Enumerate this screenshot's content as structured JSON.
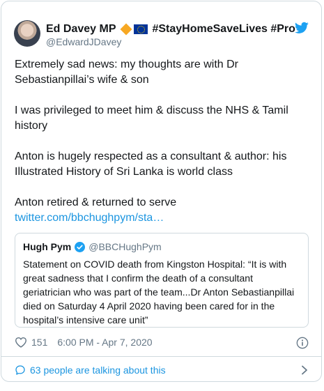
{
  "tweet": {
    "author_name": "Ed Davey MP",
    "author_tags": "#StayHomeSaveLives #Pro",
    "author_handle": "@EdwardJDavey",
    "paragraphs": [
      "Extremely sad news: my thoughts are with Dr Sebastianpillai’s wife & son",
      "I was privileged to meet him & discuss the NHS & Tamil history",
      "Anton is hugely respected as a consultant & author: his Illustrated History of Sri Lanka is world class",
      "Anton retired & returned to serve"
    ],
    "link_text": "twitter.com/bbchughpym/sta…",
    "likes": "151",
    "timestamp": "6:00 PM - Apr 7, 2020",
    "talking": "63 people are talking about this"
  },
  "quoted": {
    "name": "Hugh Pym",
    "handle": "@BBCHughPym",
    "text": "Statement on COVID death from Kingston Hospital: “It is with great sadness that I confirm the death of a consultant geriatrician who was part of the team...Dr Anton Sebastianpillai died on Saturday 4 April 2020 having been cared for in the hospital’s intensive care unit”"
  },
  "icons": {
    "author_badges": [
      "orange-diamond-icon",
      "eu-flag-icon"
    ],
    "brand": "twitter-bird-icon",
    "verified": "verified-badge-icon",
    "like": "heart-icon",
    "info": "info-icon",
    "talk": "speech-bubble-icon",
    "more": "chevron-right-icon"
  },
  "colors": {
    "link": "#1b95e0",
    "secondary_text": "#657786",
    "border": "#cfd9de",
    "diamond": "#f7a823",
    "eu_blue": "#003399"
  }
}
